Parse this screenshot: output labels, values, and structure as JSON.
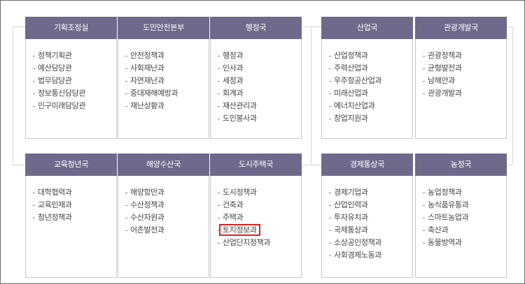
{
  "departments": [
    {
      "name": "기획조정실",
      "items": [
        "정책기획관",
        "예산담당관",
        "법무담당관",
        "정보통신담당관",
        "인구미래담당관"
      ]
    },
    {
      "name": "도민안전본부",
      "items": [
        "안전정책과",
        "사회재난과",
        "자연재난과",
        "중대재해예방과",
        "재난상황과"
      ]
    },
    {
      "name": "행정국",
      "items": [
        "행정과",
        "인사과",
        "세정과",
        "회계과",
        "재산관리과",
        "도민봉사과"
      ]
    },
    {
      "name": "산업국",
      "items": [
        "산업정책과",
        "주력산업과",
        "우주항공산업과",
        "미래산업과",
        "에너지산업과",
        "창업지원과"
      ]
    },
    {
      "name": "관광개발국",
      "items": [
        "관광정책과",
        "균형발전과",
        "남해안과",
        "관광개발과"
      ]
    },
    {
      "name": "교육청년국",
      "items": [
        "대학협력과",
        "교육인재과",
        "청년정책과"
      ]
    },
    {
      "name": "해양수산국",
      "items": [
        "해양항만과",
        "수산정책과",
        "수산자원과",
        "어촌발전과"
      ]
    },
    {
      "name": "도시주택국",
      "items": [
        "도시정책과",
        "건축과",
        "주택과",
        "토지정보과",
        "산업단지정책과"
      ],
      "highlighted": "토지정보과"
    },
    {
      "name": "경제통상국",
      "items": [
        "경제기업과",
        "산업인력과",
        "투자유치과",
        "국제통상과",
        "소상공인정책과",
        "사회경제노동과"
      ]
    },
    {
      "name": "농정국",
      "items": [
        "농업정책과",
        "농식품유통과",
        "스마트농업과",
        "축산과",
        "동물방역과"
      ]
    }
  ],
  "colors": {
    "header_bg": "#6e6a8c",
    "highlight_border": "#e02020"
  }
}
